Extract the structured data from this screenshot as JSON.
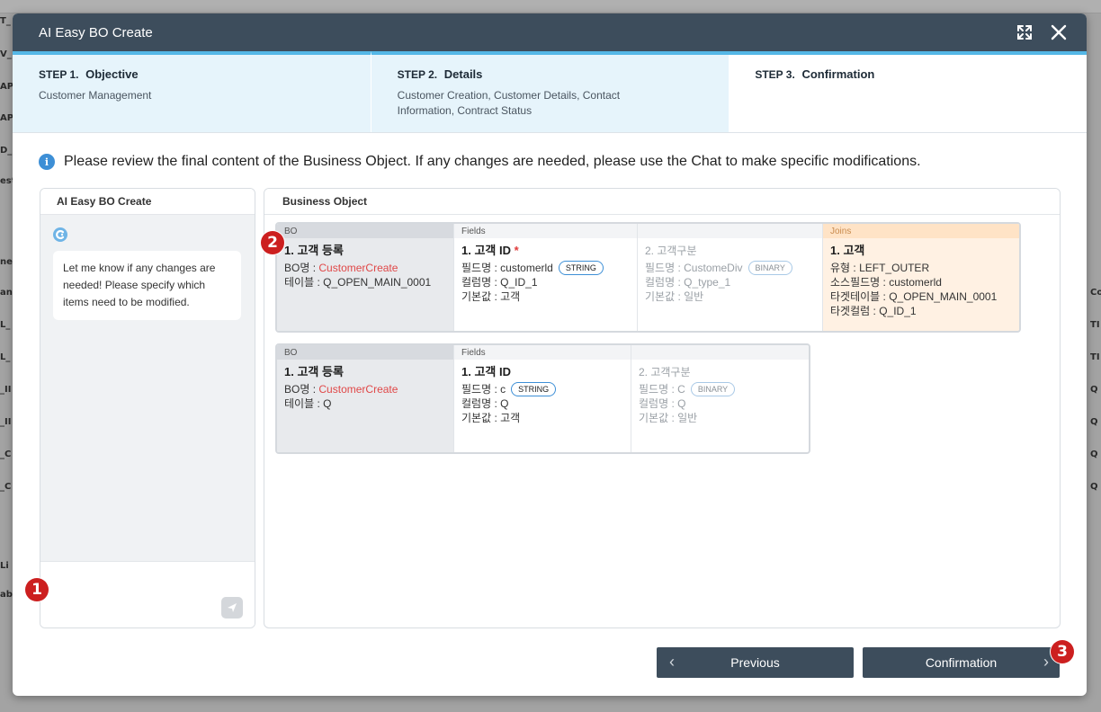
{
  "background": {
    "left_labels": [
      "T_",
      "V_",
      "AP",
      "AP",
      "D_",
      "est",
      "ne",
      "an",
      "L_",
      "L_",
      "_II",
      "_II",
      "_C",
      "_C",
      "Li",
      "ab"
    ],
    "right_labels": [
      "Co",
      "TI",
      "TI",
      "Q",
      "Q",
      "Q",
      "Q"
    ]
  },
  "modal": {
    "title": "AI Easy BO Create",
    "icons": {
      "expand": "expand-icon",
      "close": "close-icon"
    }
  },
  "steps": [
    {
      "num": "STEP 1.",
      "title": "Objective",
      "desc": "Customer Management"
    },
    {
      "num": "STEP 2.",
      "title": "Details",
      "desc": "Customer Creation, Customer Details, Contact Information, Contract Status"
    },
    {
      "num": "STEP 3.",
      "title": "Confirmation",
      "desc": ""
    }
  ],
  "notice": {
    "icon": "info-icon",
    "text": "Please review the final content of the Business Object. If any changes are needed, please use the Chat to make specific modifications."
  },
  "chat": {
    "header": "AI Easy BO Create",
    "message": "Let me know if any changes are needed! Please specify which items need to be modified.",
    "input_value": "",
    "send_icon": "send-icon"
  },
  "business_object": {
    "header": "Business Object",
    "cards": [
      {
        "bo_head": "BO",
        "fields_head": "Fields",
        "joins_head": "Joins",
        "bo": {
          "title": "1. 고객 등록",
          "name_label": "BO명 :",
          "name_value": "CustomerCreate",
          "table_label": "테이블 :",
          "table_value": "Q_OPEN_MAIN_0001"
        },
        "fields": [
          {
            "title": "1. 고객 ID",
            "required": "*",
            "field_label": "필드명 :",
            "field_value": "customerld",
            "type": "STRING",
            "col_label": "컬럼명 :",
            "col_value": "Q_ID_1",
            "default_label": "기본값 :",
            "default_value": "고객"
          },
          {
            "title": "2. 고객구분",
            "required": "",
            "field_label": "필드명 :",
            "field_value": "CustomeDiv",
            "type": "BINARY",
            "col_label": "컬럼명 :",
            "col_value": "Q_type_1",
            "default_label": "기본값 :",
            "default_value": "일반"
          }
        ],
        "joins": {
          "title": "1. 고객",
          "type_label": "유형 :",
          "type_value": "LEFT_OUTER",
          "src_label": "소스필드명 :",
          "src_value": "customerld",
          "tgt_table_label": "타겟테이블 :",
          "tgt_table_value": "Q_OPEN_MAIN_0001",
          "tgt_col_label": "타겟컬럼 :",
          "tgt_col_value": "Q_ID_1"
        }
      },
      {
        "bo_head": "BO",
        "fields_head": "Fields",
        "bo": {
          "title": "1. 고객 등록",
          "name_label": "BO명 :",
          "name_value": "CustomerCreate",
          "table_label": "테이블 :",
          "table_value": "Q"
        },
        "fields": [
          {
            "title": "1. 고객 ID",
            "field_label": "필드명 :",
            "field_value": "c",
            "type": "STRING",
            "col_label": "컬럼명 :",
            "col_value": "Q",
            "default_label": "기본값 :",
            "default_value": "고객"
          },
          {
            "title": "2. 고객구분",
            "field_label": "필드명 :",
            "field_value": "C",
            "type": "BINARY",
            "col_label": "컬럼명 :",
            "col_value": "Q",
            "default_label": "기본값 :",
            "default_value": "일반"
          }
        ]
      }
    ]
  },
  "footer": {
    "previous_label": "Previous",
    "confirm_label": "Confirmation",
    "prev_icon": "chevron-left-icon",
    "next_icon": "chevron-right-icon"
  },
  "annotations": [
    "1",
    "2",
    "3"
  ],
  "colors": {
    "header": "#3d4d5c",
    "accent": "#54b7e6",
    "step_done_bg": "#e6f4fb",
    "joins_bg": "#fff1e3",
    "badge": "#cc1f1f",
    "bo_name": "#e04848"
  }
}
